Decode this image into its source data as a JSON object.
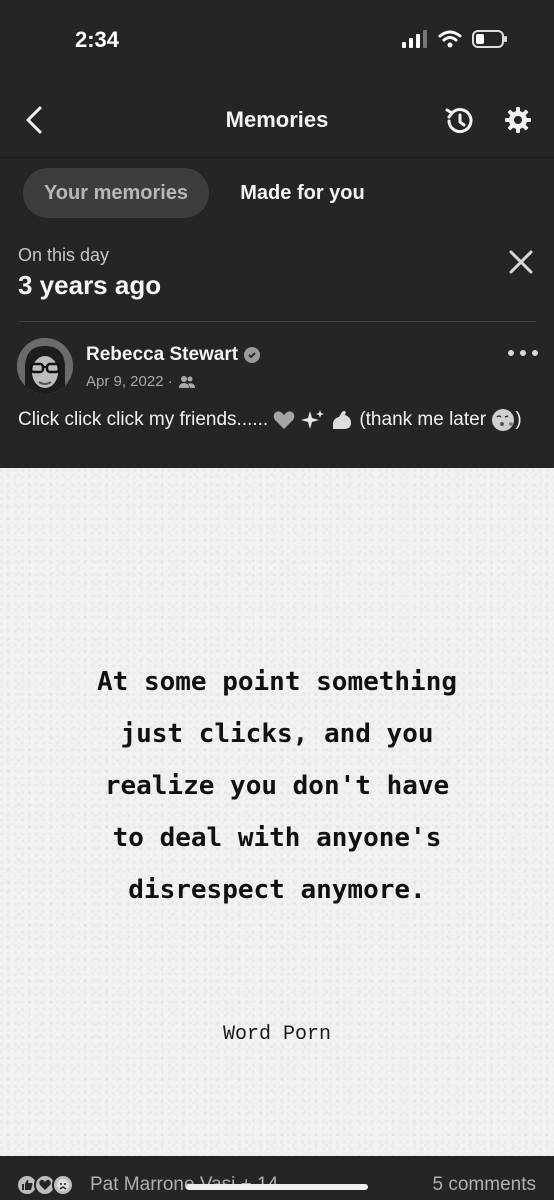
{
  "status_bar": {
    "time": "2:34"
  },
  "nav": {
    "title": "Memories"
  },
  "tabs": [
    {
      "label": "Your memories",
      "active": true
    },
    {
      "label": "Made for you",
      "active": false
    }
  ],
  "memory_header": {
    "eyebrow": "On this day",
    "title": "3 years ago"
  },
  "post": {
    "author": "Rebecca Stewart",
    "date": "Apr 9, 2022 ·",
    "text_part1": "Click click click my friends......",
    "text_part2": "(thank me later",
    "text_part3": ")"
  },
  "quote_image": {
    "lines": [
      "At some point something",
      "just clicks, and you",
      "realize you don't have",
      "to deal with anyone's",
      "disrespect anymore."
    ],
    "source": "Word Porn"
  },
  "reactions": {
    "names": "Pat Marrone Vasi + 14",
    "comments": "5 comments"
  },
  "colors": {
    "background": "#252525",
    "card_image": "#f1f1f1",
    "active_tab": "#3d3d3d"
  }
}
